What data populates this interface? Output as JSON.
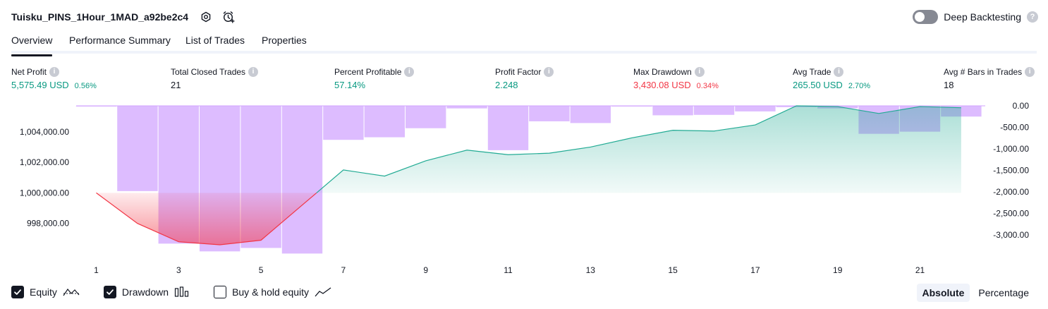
{
  "header": {
    "strategy_name": "Tuisku_PINS_1Hour_1MAD_a92be2c4",
    "settings_icon": "settings-icon",
    "add_alert_icon": "add-alert-icon",
    "deep_backtesting_label": "Deep Backtesting",
    "deep_backtesting_enabled": false
  },
  "tabs": [
    {
      "label": "Overview",
      "active": true
    },
    {
      "label": "Performance Summary",
      "active": false
    },
    {
      "label": "List of Trades",
      "active": false
    },
    {
      "label": "Properties",
      "active": false
    }
  ],
  "stats": [
    {
      "label": "Net Profit",
      "value": "5,575.49 USD",
      "sub": "0.56%",
      "color": "#089981"
    },
    {
      "label": "Total Closed Trades",
      "value": "21",
      "sub": "",
      "color": "#131722"
    },
    {
      "label": "Percent Profitable",
      "value": "57.14%",
      "sub": "",
      "color": "#089981"
    },
    {
      "label": "Profit Factor",
      "value": "2.248",
      "sub": "",
      "color": "#089981"
    },
    {
      "label": "Max Drawdown",
      "value": "3,430.08 USD",
      "sub": "0.34%",
      "color": "#f23645"
    },
    {
      "label": "Avg Trade",
      "value": "265.50 USD",
      "sub": "2.70%",
      "color": "#089981"
    },
    {
      "label": "Avg # Bars in Trades",
      "value": "18",
      "sub": "",
      "color": "#131722"
    }
  ],
  "chart_data": {
    "type": "line",
    "x_ticks": [
      "1",
      "3",
      "5",
      "7",
      "9",
      "11",
      "13",
      "15",
      "17",
      "19",
      "21"
    ],
    "equity": {
      "x": [
        1,
        2,
        3,
        4,
        5,
        6,
        7,
        8,
        9,
        10,
        11,
        12,
        13,
        14,
        15,
        16,
        17,
        18,
        19,
        20,
        21,
        22
      ],
      "values": [
        1000000,
        998000,
        996800,
        996600,
        996900,
        999200,
        1001500,
        1001100,
        1002100,
        1002800,
        1002500,
        1002600,
        1003000,
        1003600,
        1004100,
        1004050,
        1004450,
        1005700,
        1005650,
        1005200,
        1005650,
        1005575
      ],
      "ylim": [
        996000,
        1005700
      ],
      "y_ticks": [
        {
          "value": 998000,
          "label": "998,000.00"
        },
        {
          "value": 1000000,
          "label": "1,000,000.00"
        },
        {
          "value": 1002000,
          "label": "1,002,000.00"
        },
        {
          "value": 1004000,
          "label": "1,004,000.00"
        }
      ],
      "color_above": "#22ab94",
      "color_below": "#f23645",
      "baseline": 1000000
    },
    "drawdown": {
      "x": [
        1,
        2,
        3,
        4,
        5,
        6,
        7,
        8,
        9,
        10,
        11,
        12,
        13,
        14,
        15,
        16,
        17,
        18,
        19,
        20,
        21,
        22
      ],
      "values": [
        -5,
        -1980,
        -3200,
        -3380,
        -3300,
        -3430,
        -790,
        -730,
        -520,
        -60,
        -1030,
        -360,
        -400,
        -5,
        -220,
        -210,
        -130,
        -30,
        -60,
        -650,
        -600,
        -250
      ],
      "ylim": [
        -3440,
        0
      ],
      "y_ticks": [
        {
          "value": 0,
          "label": "0.00"
        },
        {
          "value": -500,
          "label": "-500.00"
        },
        {
          "value": -1000,
          "label": "-1,000.00"
        },
        {
          "value": -1500,
          "label": "-1,500.00"
        },
        {
          "value": -2000,
          "label": "-2,000.00"
        },
        {
          "value": -2500,
          "label": "-2,500.00"
        },
        {
          "value": -3000,
          "label": "-3,000.00"
        }
      ],
      "color": "#d1a6ff"
    }
  },
  "legend": [
    {
      "label": "Equity",
      "checked": true,
      "icon": "equity-line-icon"
    },
    {
      "label": "Drawdown",
      "checked": true,
      "icon": "drawdown-bars-icon"
    },
    {
      "label": "Buy & hold equity",
      "checked": false,
      "icon": "buy-hold-line-icon"
    }
  ],
  "modes": [
    {
      "label": "Absolute",
      "active": true
    },
    {
      "label": "Percentage",
      "active": false
    }
  ]
}
